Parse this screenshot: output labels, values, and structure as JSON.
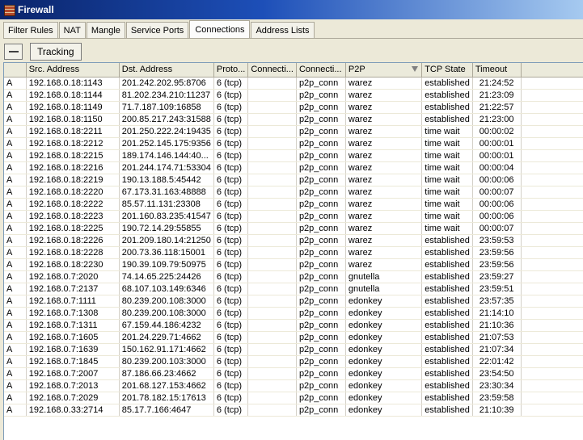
{
  "window": {
    "title": "Firewall"
  },
  "tabs": [
    {
      "label": "Filter Rules",
      "active": false
    },
    {
      "label": "NAT",
      "active": false
    },
    {
      "label": "Mangle",
      "active": false
    },
    {
      "label": "Service Ports",
      "active": false
    },
    {
      "label": "Connections",
      "active": true
    },
    {
      "label": "Address Lists",
      "active": false
    }
  ],
  "toolbar": {
    "remove_icon": "minus-icon",
    "tracking_label": "Tracking"
  },
  "table": {
    "columns": [
      "",
      "Src. Address",
      "Dst. Address",
      "Proto...",
      "Connecti...",
      "Connecti...",
      "P2P",
      "TCP State",
      "Timeout"
    ],
    "sorted_column": "P2P",
    "rows": [
      [
        "A",
        "192.168.0.18:1143",
        "201.242.202.95:8706",
        "6 (tcp)",
        "",
        "p2p_conn",
        "warez",
        "established",
        "21:24:52"
      ],
      [
        "A",
        "192.168.0.18:1144",
        "81.202.234.210:11237",
        "6 (tcp)",
        "",
        "p2p_conn",
        "warez",
        "established",
        "21:23:09"
      ],
      [
        "A",
        "192.168.0.18:1149",
        "71.7.187.109:16858",
        "6 (tcp)",
        "",
        "p2p_conn",
        "warez",
        "established",
        "21:22:57"
      ],
      [
        "A",
        "192.168.0.18:1150",
        "200.85.217.243:31588",
        "6 (tcp)",
        "",
        "p2p_conn",
        "warez",
        "established",
        "21:23:00"
      ],
      [
        "A",
        "192.168.0.18:2211",
        "201.250.222.24:19435",
        "6 (tcp)",
        "",
        "p2p_conn",
        "warez",
        "time wait",
        "00:00:02"
      ],
      [
        "A",
        "192.168.0.18:2212",
        "201.252.145.175:9356",
        "6 (tcp)",
        "",
        "p2p_conn",
        "warez",
        "time wait",
        "00:00:01"
      ],
      [
        "A",
        "192.168.0.18:2215",
        "189.174.146.144:40...",
        "6 (tcp)",
        "",
        "p2p_conn",
        "warez",
        "time wait",
        "00:00:01"
      ],
      [
        "A",
        "192.168.0.18:2216",
        "201.244.174.71:53304",
        "6 (tcp)",
        "",
        "p2p_conn",
        "warez",
        "time wait",
        "00:00:04"
      ],
      [
        "A",
        "192.168.0.18:2219",
        "190.13.188.5:45442",
        "6 (tcp)",
        "",
        "p2p_conn",
        "warez",
        "time wait",
        "00:00:06"
      ],
      [
        "A",
        "192.168.0.18:2220",
        "67.173.31.163:48888",
        "6 (tcp)",
        "",
        "p2p_conn",
        "warez",
        "time wait",
        "00:00:07"
      ],
      [
        "A",
        "192.168.0.18:2222",
        "85.57.11.131:23308",
        "6 (tcp)",
        "",
        "p2p_conn",
        "warez",
        "time wait",
        "00:00:06"
      ],
      [
        "A",
        "192.168.0.18:2223",
        "201.160.83.235:41547",
        "6 (tcp)",
        "",
        "p2p_conn",
        "warez",
        "time wait",
        "00:00:06"
      ],
      [
        "A",
        "192.168.0.18:2225",
        "190.72.14.29:55855",
        "6 (tcp)",
        "",
        "p2p_conn",
        "warez",
        "time wait",
        "00:00:07"
      ],
      [
        "A",
        "192.168.0.18:2226",
        "201.209.180.14:21250",
        "6 (tcp)",
        "",
        "p2p_conn",
        "warez",
        "established",
        "23:59:53"
      ],
      [
        "A",
        "192.168.0.18:2228",
        "200.73.36.118:15001",
        "6 (tcp)",
        "",
        "p2p_conn",
        "warez",
        "established",
        "23:59:56"
      ],
      [
        "A",
        "192.168.0.18:2230",
        "190.39.109.79:50975",
        "6 (tcp)",
        "",
        "p2p_conn",
        "warez",
        "established",
        "23:59:56"
      ],
      [
        "A",
        "192.168.0.7:2020",
        "74.14.65.225:24426",
        "6 (tcp)",
        "",
        "p2p_conn",
        "gnutella",
        "established",
        "23:59:27"
      ],
      [
        "A",
        "192.168.0.7:2137",
        "68.107.103.149:6346",
        "6 (tcp)",
        "",
        "p2p_conn",
        "gnutella",
        "established",
        "23:59:51"
      ],
      [
        "A",
        "192.168.0.7:1111",
        "80.239.200.108:3000",
        "6 (tcp)",
        "",
        "p2p_conn",
        "edonkey",
        "established",
        "23:57:35"
      ],
      [
        "A",
        "192.168.0.7:1308",
        "80.239.200.108:3000",
        "6 (tcp)",
        "",
        "p2p_conn",
        "edonkey",
        "established",
        "21:14:10"
      ],
      [
        "A",
        "192.168.0.7:1311",
        "67.159.44.186:4232",
        "6 (tcp)",
        "",
        "p2p_conn",
        "edonkey",
        "established",
        "21:10:36"
      ],
      [
        "A",
        "192.168.0.7:1605",
        "201.24.229.71:4662",
        "6 (tcp)",
        "",
        "p2p_conn",
        "edonkey",
        "established",
        "21:07:53"
      ],
      [
        "A",
        "192.168.0.7:1639",
        "150.162.91.171:4662",
        "6 (tcp)",
        "",
        "p2p_conn",
        "edonkey",
        "established",
        "21:07:34"
      ],
      [
        "A",
        "192.168.0.7:1845",
        "80.239.200.103:3000",
        "6 (tcp)",
        "",
        "p2p_conn",
        "edonkey",
        "established",
        "22:01:42"
      ],
      [
        "A",
        "192.168.0.7:2007",
        "87.186.66.23:4662",
        "6 (tcp)",
        "",
        "p2p_conn",
        "edonkey",
        "established",
        "23:54:50"
      ],
      [
        "A",
        "192.168.0.7:2013",
        "201.68.127.153:4662",
        "6 (tcp)",
        "",
        "p2p_conn",
        "edonkey",
        "established",
        "23:30:34"
      ],
      [
        "A",
        "192.168.0.7:2029",
        "201.78.182.15:17613",
        "6 (tcp)",
        "",
        "p2p_conn",
        "edonkey",
        "established",
        "23:59:58"
      ],
      [
        "A",
        "192.168.0.33:2714",
        "85.17.7.166:4647",
        "6 (tcp)",
        "",
        "p2p_conn",
        "edonkey",
        "established",
        "21:10:39"
      ]
    ]
  }
}
